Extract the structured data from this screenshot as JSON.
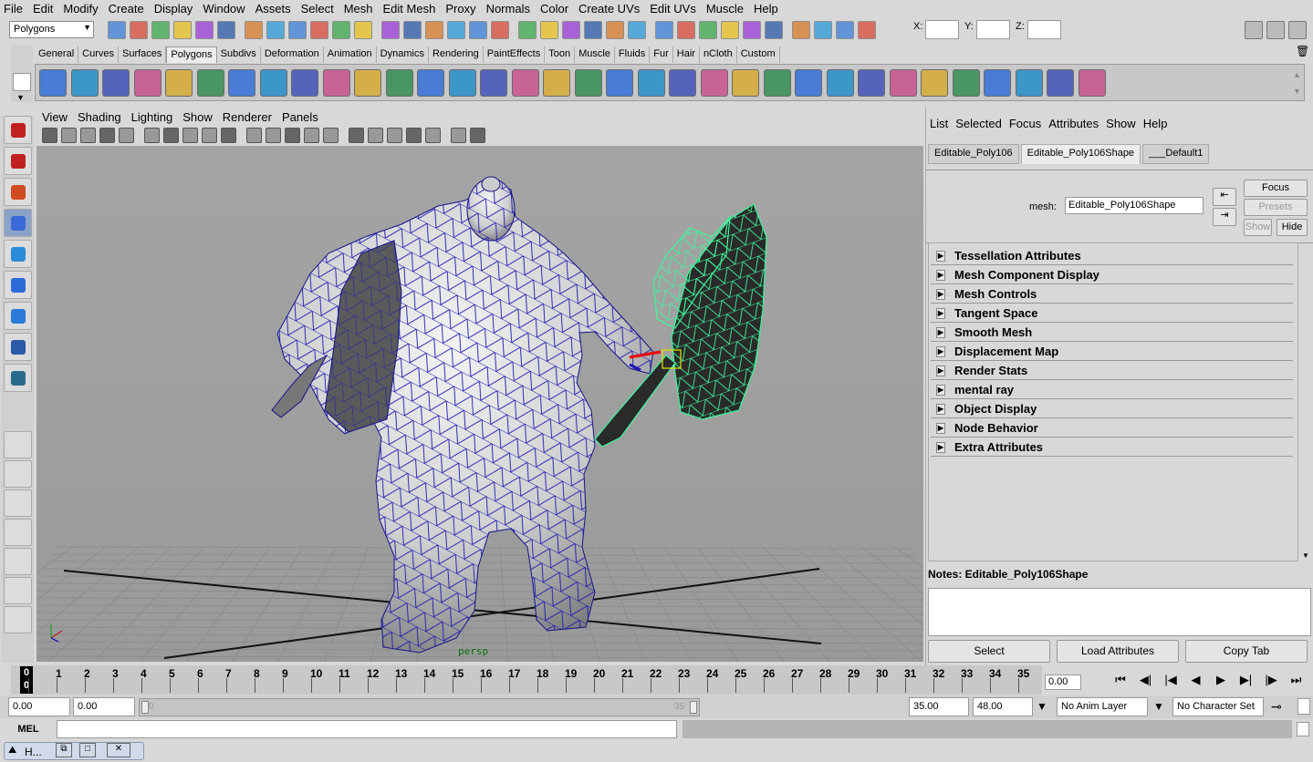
{
  "menu": [
    "File",
    "Edit",
    "Modify",
    "Create",
    "Display",
    "Window",
    "Assets",
    "Select",
    "Mesh",
    "Edit Mesh",
    "Proxy",
    "Normals",
    "Color",
    "Create UVs",
    "Edit UVs",
    "Muscle",
    "Help"
  ],
  "status": {
    "mode": "Polygons",
    "x_label": "X:",
    "y_label": "Y:",
    "z_label": "Z:"
  },
  "shelf_tabs": [
    "General",
    "Curves",
    "Surfaces",
    "Polygons",
    "Subdivs",
    "Deformation",
    "Animation",
    "Dynamics",
    "Rendering",
    "PaintEffects",
    "Toon",
    "Muscle",
    "Fluids",
    "Fur",
    "Hair",
    "nCloth",
    "Custom"
  ],
  "shelf_active": "Polygons",
  "panel_menu": [
    "View",
    "Shading",
    "Lighting",
    "Show",
    "Renderer",
    "Panels"
  ],
  "viewport": {
    "camera_label": "persp"
  },
  "attribute_editor": {
    "menu": [
      "List",
      "Selected",
      "Focus",
      "Attributes",
      "Show",
      "Help"
    ],
    "tabs": [
      "Editable_Poly106",
      "Editable_Poly106Shape",
      "___Default1"
    ],
    "active_tab": "Editable_Poly106Shape",
    "mesh_label": "mesh:",
    "mesh_value": "Editable_Poly106Shape",
    "focus": "Focus",
    "presets": "Presets",
    "show": "Show",
    "hide": "Hide",
    "sections": [
      "Tessellation Attributes",
      "Mesh Component Display",
      "Mesh Controls",
      "Tangent Space",
      "Smooth Mesh",
      "Displacement Map",
      "Render Stats",
      "mental ray",
      "Object Display",
      "Node Behavior",
      "Extra Attributes"
    ],
    "notes_label": "Notes:  Editable_Poly106Shape",
    "buttons": [
      "Select",
      "Load Attributes",
      "Copy Tab"
    ]
  },
  "timeline": {
    "frames": [
      "0",
      "1",
      "2",
      "3",
      "4",
      "5",
      "6",
      "7",
      "8",
      "9",
      "10",
      "11",
      "12",
      "13",
      "14",
      "15",
      "16",
      "17",
      "18",
      "19",
      "20",
      "21",
      "22",
      "23",
      "24",
      "25",
      "26",
      "27",
      "28",
      "29",
      "30",
      "31",
      "32",
      "33",
      "34",
      "35"
    ],
    "current_frame": "0",
    "current_time": "0.00"
  },
  "range": {
    "start": "0.00",
    "playback_start": "0.00",
    "range_start_label": "0",
    "range_end_label": "35",
    "playback_end": "35.00",
    "end": "48.00",
    "anim_layer": "No Anim Layer",
    "character_set": "No Character Set"
  },
  "mel": {
    "label": "MEL"
  },
  "taskbar": {
    "label": "H..."
  }
}
